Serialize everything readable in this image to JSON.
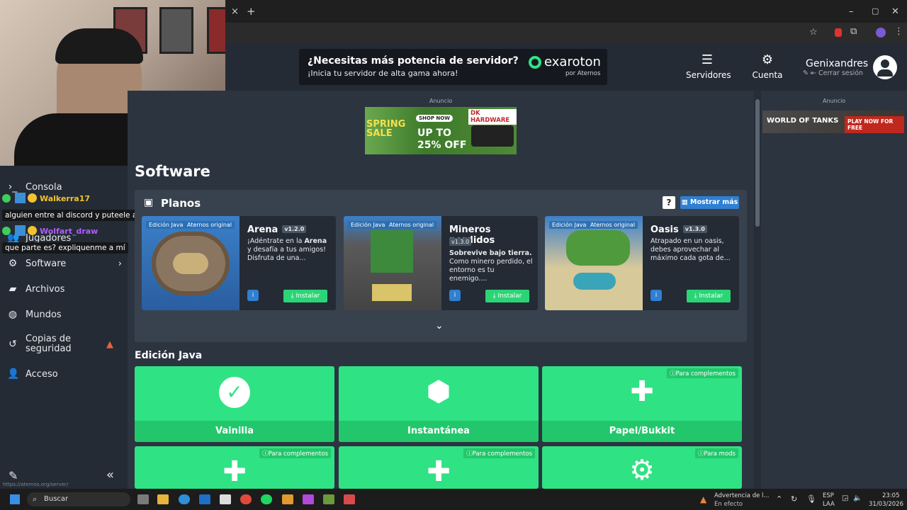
{
  "browser": {
    "tabs": [
      "×",
      "+"
    ],
    "window_controls": [
      "–",
      "▢",
      "✕"
    ],
    "url_hint": "https://aternos.org/server/"
  },
  "header": {
    "ad_title": "¿Necesitas más potencia de servidor?",
    "ad_sub": "¡Inicia tu servidor de alta gama ahora!",
    "ad_brand": "exaroton",
    "ad_brand_sub": "por Aternos",
    "servers_label": "Servidores",
    "account_label": "Cuenta",
    "username": "Genixandres",
    "logout_label": "Cerrar sesión"
  },
  "ads": {
    "center_label": "Anuncio",
    "right_label": "Anuncio",
    "spring_text": "SPRING SALE",
    "shop_now": "SHOP NOW",
    "up_to": "UP TO",
    "percent": "25% OFF",
    "brand": "DK HARDWARE",
    "wot_title": "WORLD OF TANKS",
    "wot_cta": "PLAY NOW FOR FREE"
  },
  "sidebar": {
    "items": [
      {
        "label": "Consola",
        "icon": "console-icon"
      },
      {
        "label": "Jugadores",
        "icon": "players-icon"
      },
      {
        "label": "Software",
        "icon": "software-icon"
      },
      {
        "label": "Archivos",
        "icon": "folder-icon"
      },
      {
        "label": "Mundos",
        "icon": "globe-icon"
      },
      {
        "label": "Copias de seguridad",
        "icon": "history-icon"
      },
      {
        "label": "Acceso",
        "icon": "user-icon"
      }
    ],
    "collapse": "«"
  },
  "chat": [
    {
      "name": "Walkerra17",
      "message": "alguien entre al discord y puteele al genix",
      "color": "#f2c230"
    },
    {
      "name": "Wolfart_draw",
      "message": "que parte es? expliquenme a mí",
      "color": "#b15cff"
    }
  ],
  "page": {
    "title": "Software",
    "planos_title": "Planos",
    "help": "?",
    "show_more": "Mostrar más",
    "cards": [
      {
        "badge1": "Edición Java",
        "badge2": "Aternos original",
        "title": "Arena",
        "version": "v1.2.0",
        "desc_pre": "¡Adéntrate en la ",
        "desc_bold": "Arena",
        "desc_post": " y desafía a tus amigos! Disfruta de una...",
        "install": "Instalar"
      },
      {
        "badge1": "Edición Java",
        "badge2": "Aternos original",
        "title": "Mineros perdidos",
        "version": "v1.3.0",
        "desc_bold": "Sobrevive bajo tierra.",
        "desc_post": "Como minero perdido, el entorno es tu enemigo....",
        "install": "Instalar"
      },
      {
        "badge1": "Edición Java",
        "badge2": "Aternos original",
        "title": "Oasis",
        "version": "v1.3.0",
        "desc_post": "Atrapado en un oasis, debes aprovechar al máximo cada gota de...",
        "install": "Instalar"
      }
    ],
    "java_title": "Edición Java",
    "tiles": [
      {
        "label": "Vainilla",
        "tag": ""
      },
      {
        "label": "Instantánea",
        "tag": ""
      },
      {
        "label": "Papel/Bukkit",
        "tag": "Para complementos"
      },
      {
        "label": "",
        "tag": "Para complementos"
      },
      {
        "label": "",
        "tag": "Para complementos"
      },
      {
        "label": "",
        "tag": "Para mods"
      }
    ]
  },
  "taskbar": {
    "search": "Buscar",
    "weather_title": "Advertencia de l...",
    "weather_sub": "En efecto",
    "lang1": "ESP",
    "lang2": "LAA",
    "time": "23:05",
    "date": "31/03/2026"
  }
}
